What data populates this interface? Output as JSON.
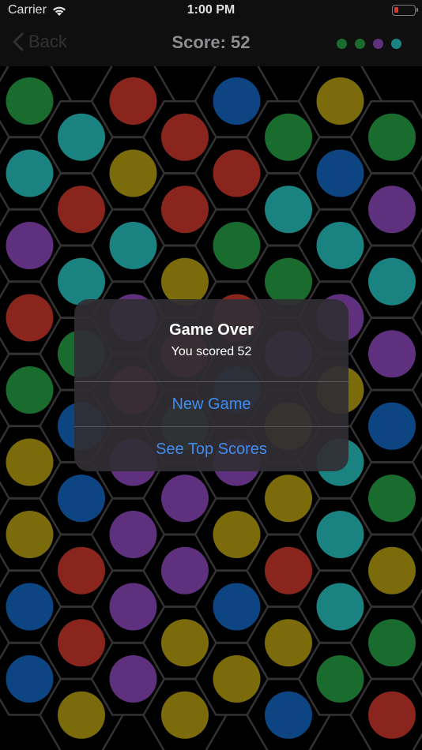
{
  "status_bar": {
    "carrier": "Carrier",
    "time": "1:00 PM"
  },
  "nav": {
    "back_label": "Back",
    "title": "Score: 52"
  },
  "colors": {
    "G": "#1e7a35",
    "C": "#1e9592",
    "R": "#9e2b23",
    "B": "#0f4f94",
    "Y": "#8c7a0d",
    "P": "#6b378f",
    "cell_border": "#3a3a3a",
    "cell_fill": "#000000"
  },
  "legend": [
    "G",
    "G",
    "P",
    "C"
  ],
  "board": {
    "columns": [
      [
        "G",
        "C",
        "P",
        "R",
        "G",
        "Y",
        "Y",
        "B",
        "B"
      ],
      [
        "C",
        "R",
        "C",
        "G",
        "B",
        "B",
        "R",
        "R",
        "Y"
      ],
      [
        "R",
        "Y",
        "C",
        "P",
        "R",
        "P",
        "P",
        "P",
        "P"
      ],
      [
        "R",
        "R",
        "Y",
        "R",
        "G",
        "P",
        "P",
        "Y",
        "Y"
      ],
      [
        "B",
        "R",
        "G",
        "R",
        "B",
        "P",
        "Y",
        "B",
        "Y"
      ],
      [
        "G",
        "C",
        "G",
        "P",
        "Y",
        "Y",
        "R",
        "Y",
        "B"
      ],
      [
        "Y",
        "B",
        "C",
        "P",
        "Y",
        "C",
        "C",
        "C",
        "G"
      ],
      [
        "G",
        "P",
        "C",
        "P",
        "B",
        "G",
        "Y",
        "G",
        "R"
      ]
    ]
  },
  "alert": {
    "title": "Game Over",
    "message": "You scored 52",
    "buttons": [
      "New Game",
      "See Top Scores"
    ]
  }
}
